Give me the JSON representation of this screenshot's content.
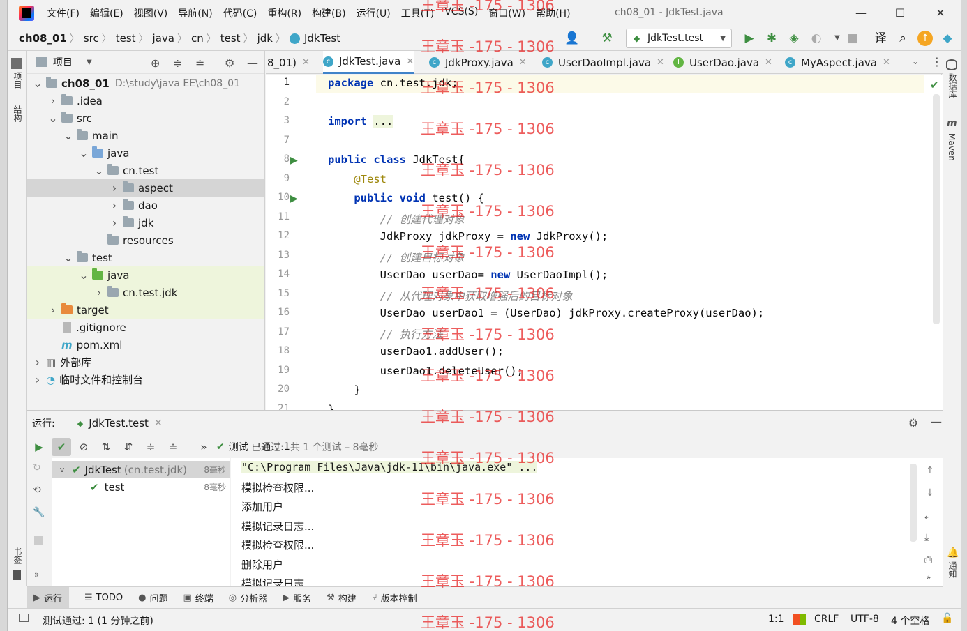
{
  "menu": [
    "文件(F)",
    "编辑(E)",
    "视图(V)",
    "导航(N)",
    "代码(C)",
    "重构(R)",
    "构建(B)",
    "运行(U)",
    "工具(T)",
    "VCS(S)",
    "窗口(W)",
    "帮助(H)"
  ],
  "window_title": "ch08_01 - JdkTest.java",
  "breadcrumbs": [
    "ch08_01",
    "src",
    "test",
    "java",
    "cn",
    "test",
    "jdk",
    "JdkTest"
  ],
  "run_config": "JdkTest.test",
  "left_strip": {
    "project": "项目",
    "structure": "结构",
    "bookmarks": "书签"
  },
  "right_strip": {
    "database": "数据库",
    "maven": "Maven",
    "notifications": "通知"
  },
  "project_panel": {
    "title": "项目"
  },
  "tree": [
    {
      "label": "ch08_01",
      "extra": "D:\\study\\java EE\\ch08_01",
      "indent": 0,
      "arrow": "v",
      "icon": "module",
      "bold": true
    },
    {
      "label": ".idea",
      "indent": 1,
      "arrow": ">",
      "icon": "gray"
    },
    {
      "label": "src",
      "indent": 1,
      "arrow": "v",
      "icon": "gray"
    },
    {
      "label": "main",
      "indent": 2,
      "arrow": "v",
      "icon": "gray"
    },
    {
      "label": "java",
      "indent": 3,
      "arrow": "v",
      "icon": "blue"
    },
    {
      "label": "cn.test",
      "indent": 4,
      "arrow": "v",
      "icon": "pkg"
    },
    {
      "label": "aspect",
      "indent": 5,
      "arrow": ">",
      "icon": "pkg",
      "selected": true
    },
    {
      "label": "dao",
      "indent": 5,
      "arrow": ">",
      "icon": "pkg"
    },
    {
      "label": "jdk",
      "indent": 5,
      "arrow": ">",
      "icon": "pkg"
    },
    {
      "label": "resources",
      "indent": 4,
      "arrow": "",
      "icon": "gray"
    },
    {
      "label": "test",
      "indent": 2,
      "arrow": "v",
      "icon": "gray"
    },
    {
      "label": "java",
      "indent": 3,
      "arrow": "v",
      "icon": "green",
      "highlight": true
    },
    {
      "label": "cn.test.jdk",
      "indent": 4,
      "arrow": ">",
      "icon": "pkg",
      "highlight": true
    },
    {
      "label": "target",
      "indent": 1,
      "arrow": ">",
      "icon": "orange",
      "highlight": true
    },
    {
      "label": ".gitignore",
      "indent": 1,
      "arrow": "",
      "icon": "file"
    },
    {
      "label": "pom.xml",
      "indent": 1,
      "arrow": "",
      "icon": "maven"
    },
    {
      "label": "外部库",
      "indent": 0,
      "arrow": ">",
      "icon": "lib"
    },
    {
      "label": "临时文件和控制台",
      "indent": 0,
      "arrow": ">",
      "icon": "scratch"
    }
  ],
  "editor_tabs": [
    {
      "label": "8_01)",
      "type": "none"
    },
    {
      "label": "JdkTest.java",
      "type": "c",
      "active": true
    },
    {
      "label": "JdkProxy.java",
      "type": "c"
    },
    {
      "label": "UserDaoImpl.java",
      "type": "c"
    },
    {
      "label": "UserDao.java",
      "type": "i"
    },
    {
      "label": "MyAspect.java",
      "type": "c"
    }
  ],
  "code_lines": [
    {
      "n": "1",
      "html": "<span class='kw'>package</span> cn.test.jdk;"
    },
    {
      "n": "2",
      "html": ""
    },
    {
      "n": "3",
      "html": "<span class='kw'>import</span> <span style='background:#eef5dc'>...</span>"
    },
    {
      "n": "7",
      "html": ""
    },
    {
      "n": "8",
      "html": "<span class='kw'>public class</span> JdkTest{"
    },
    {
      "n": "9",
      "html": "    <span class='ann'>@Test</span>"
    },
    {
      "n": "10",
      "html": "    <span class='kw'>public void</span> test() {"
    },
    {
      "n": "11",
      "html": "        <span class='cm'>// 创建代理对象</span>"
    },
    {
      "n": "12",
      "html": "        JdkProxy jdkProxy = <span class='kw'>new</span> JdkProxy();"
    },
    {
      "n": "13",
      "html": "        <span class='cm'>// 创建目标对象</span>"
    },
    {
      "n": "14",
      "html": "        UserDao userDao= <span class='kw'>new</span> UserDaoImpl();"
    },
    {
      "n": "15",
      "html": "        <span class='cm'>// 从代理对象中获取增强后的目标对象</span>"
    },
    {
      "n": "16",
      "html": "        UserDao userDao1 = (UserDao) jdkProxy.createProxy(userDao);"
    },
    {
      "n": "17",
      "html": "        <span class='cm'>// 执行方法</span>"
    },
    {
      "n": "18",
      "html": "        userDao1.addUser();"
    },
    {
      "n": "19",
      "html": "        userDao1.deleteUser();"
    },
    {
      "n": "20",
      "html": "    }"
    },
    {
      "n": "21",
      "html": "}"
    }
  ],
  "watermark": "王章玉 -175 - 1306",
  "run_panel": {
    "label": "运行:",
    "tab": "JdkTest.test",
    "status_prefix": "测试 已通过: ",
    "status_count": "1",
    "status_suffix": "共 1 个测试 – 8毫秒"
  },
  "tests": [
    {
      "label": "JdkTest",
      "pkg": "(cn.test.jdk)",
      "time": "8毫秒"
    },
    {
      "label": "test",
      "pkg": "",
      "time": "8毫秒"
    }
  ],
  "console_lines": [
    "\"C:\\Program Files\\Java\\jdk-11\\bin\\java.exe\" ...",
    "模拟检查权限...",
    "添加用户",
    "模拟记录日志...",
    "模拟检查权限...",
    "删除用户",
    "模拟记录日志..."
  ],
  "bottom_tabs": [
    {
      "icon": "▶",
      "label": "运行",
      "active": true
    },
    {
      "icon": "☰",
      "label": "TODO"
    },
    {
      "icon": "●",
      "label": "问题"
    },
    {
      "icon": "▣",
      "label": "终端"
    },
    {
      "icon": "◎",
      "label": "分析器"
    },
    {
      "icon": "▶",
      "label": "服务"
    },
    {
      "icon": "⚒",
      "label": "构建"
    },
    {
      "icon": "⑂",
      "label": "版本控制"
    }
  ],
  "status": {
    "message": "测试通过: 1 (1 分钟之前)",
    "position": "1:1",
    "line_sep": "CRLF",
    "encoding": "UTF-8",
    "indent": "4 个空格"
  }
}
